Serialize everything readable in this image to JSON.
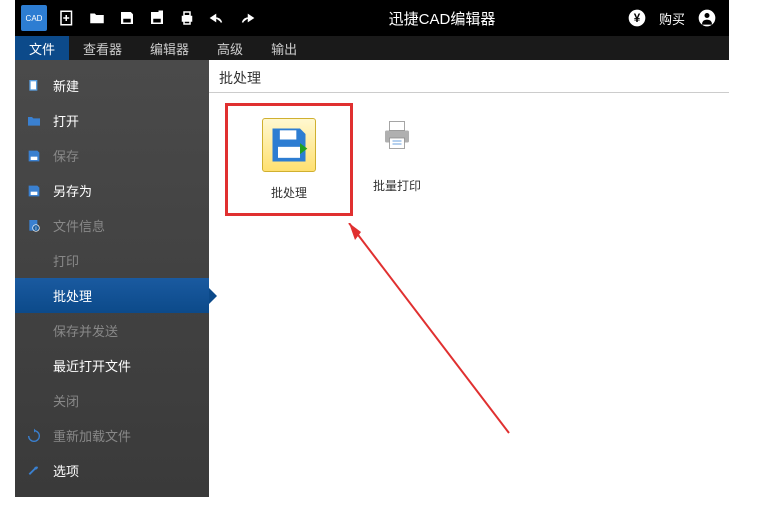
{
  "app": {
    "title": "迅捷CAD编辑器",
    "logo_text": "CAD"
  },
  "titlebar_right": {
    "buy": "购买"
  },
  "tabs": [
    {
      "label": "文件",
      "active": true
    },
    {
      "label": "查看器",
      "active": false
    },
    {
      "label": "编辑器",
      "active": false
    },
    {
      "label": "高级",
      "active": false
    },
    {
      "label": "输出",
      "active": false
    }
  ],
  "sidebar": [
    {
      "label": "新建",
      "icon": "file-new",
      "state": "category"
    },
    {
      "label": "打开",
      "icon": "folder-open",
      "state": "category"
    },
    {
      "label": "保存",
      "icon": "save",
      "state": "disabled"
    },
    {
      "label": "另存为",
      "icon": "save-as",
      "state": "category"
    },
    {
      "label": "文件信息",
      "icon": "file-info",
      "state": "disabled"
    },
    {
      "label": "打印",
      "icon": "",
      "state": "disabled"
    },
    {
      "label": "批处理",
      "icon": "",
      "state": "active"
    },
    {
      "label": "保存并发送",
      "icon": "",
      "state": "disabled"
    },
    {
      "label": "最近打开文件",
      "icon": "",
      "state": "category"
    },
    {
      "label": "关闭",
      "icon": "",
      "state": "disabled"
    },
    {
      "label": "重新加载文件",
      "icon": "reload",
      "state": "disabled"
    },
    {
      "label": "选项",
      "icon": "wrench",
      "state": "category"
    }
  ],
  "content": {
    "title": "批处理",
    "items": [
      {
        "label": "批处理",
        "icon": "batch-save",
        "highlighted": true
      },
      {
        "label": "批量打印",
        "icon": "batch-print",
        "highlighted": false
      }
    ]
  }
}
